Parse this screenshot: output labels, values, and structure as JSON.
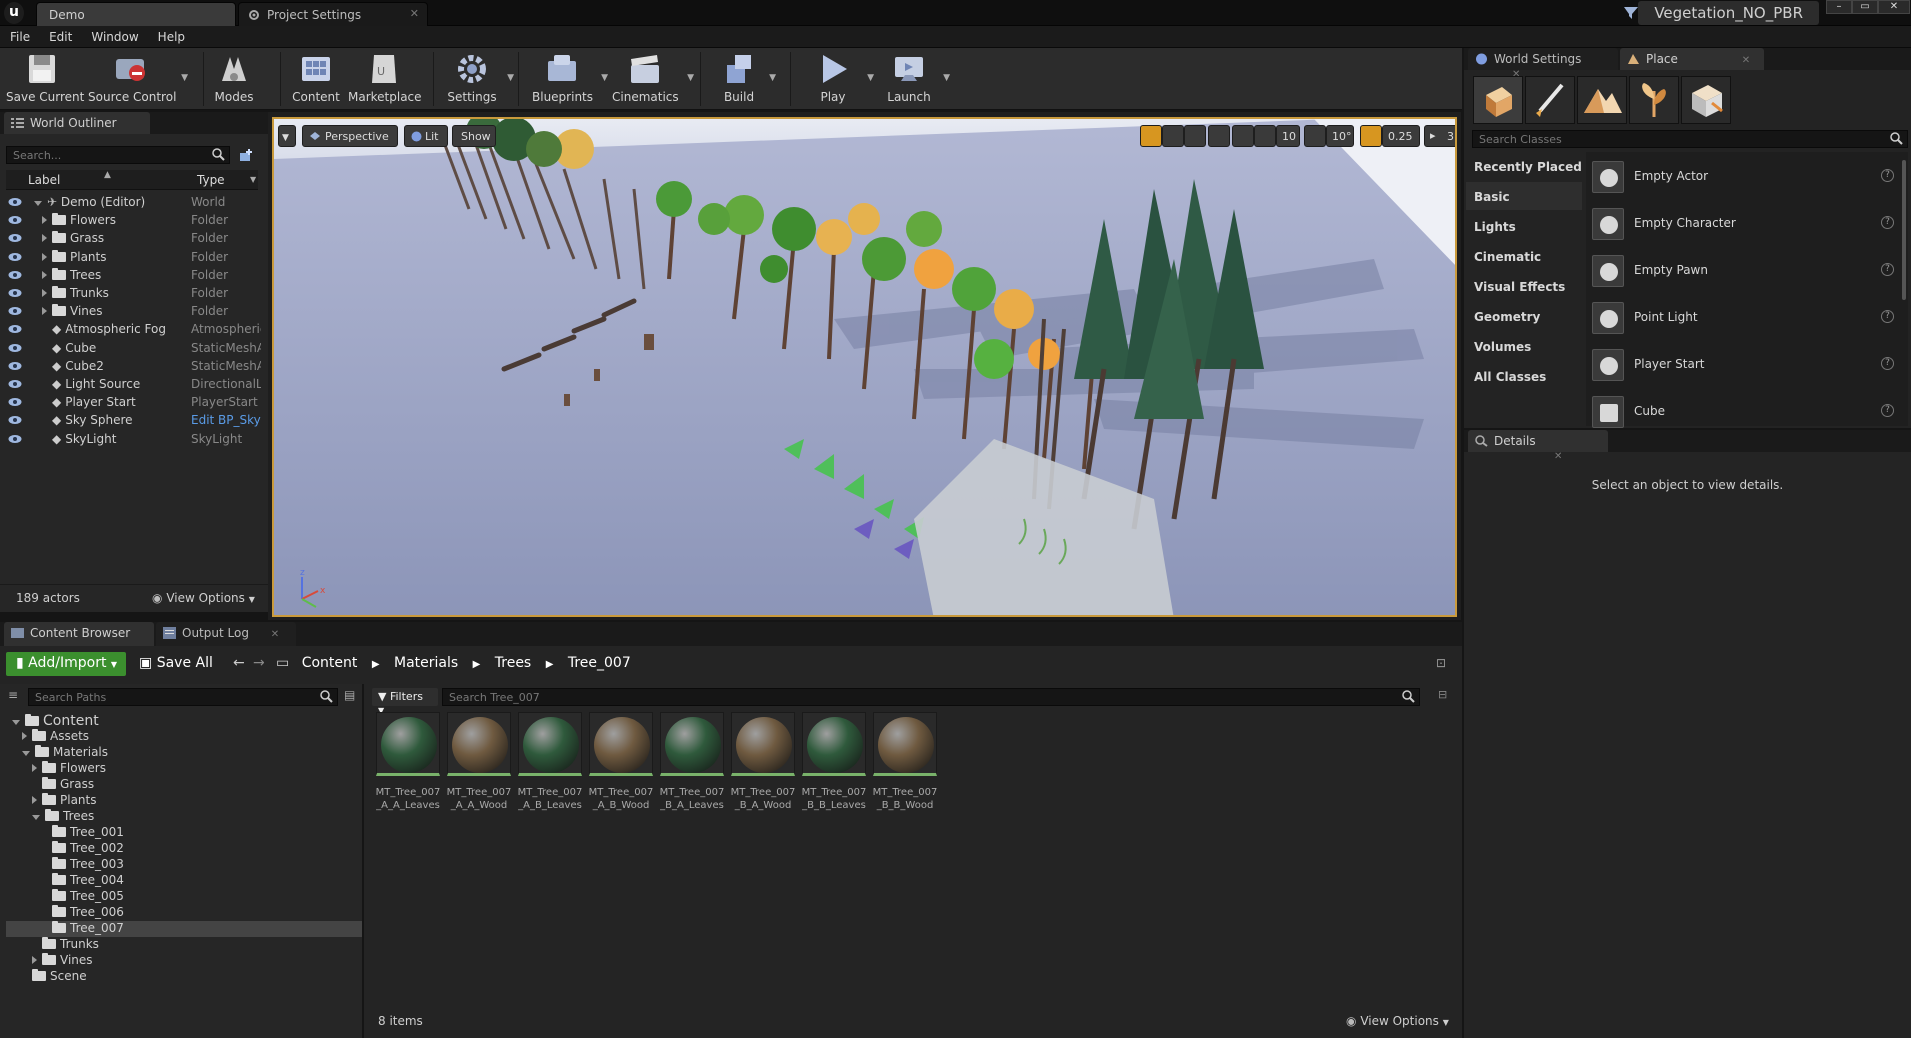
{
  "window": {
    "tabs": [
      {
        "label": "Demo"
      },
      {
        "label": "Project Settings"
      }
    ],
    "project_name": "Vegetation_NO_PBR",
    "controls": {
      "minimize": "–",
      "maximize": "▭",
      "close": "✕"
    }
  },
  "menu": {
    "items": [
      "File",
      "Edit",
      "Window",
      "Help"
    ]
  },
  "toolbar": {
    "buttons": [
      {
        "label": "Save Current",
        "icon": "save-icon"
      },
      {
        "label": "Source Control",
        "icon": "source-control-icon"
      },
      {
        "label": "Modes",
        "icon": "modes-icon"
      },
      {
        "label": "Content",
        "icon": "content-icon"
      },
      {
        "label": "Marketplace",
        "icon": "marketplace-icon"
      },
      {
        "label": "Settings",
        "icon": "settings-icon"
      },
      {
        "label": "Blueprints",
        "icon": "blueprints-icon"
      },
      {
        "label": "Cinematics",
        "icon": "cinematics-icon"
      },
      {
        "label": "Build",
        "icon": "build-icon"
      },
      {
        "label": "Play",
        "icon": "play-icon"
      },
      {
        "label": "Launch",
        "icon": "launch-icon"
      }
    ]
  },
  "outliner": {
    "tab": "World Outliner",
    "search_placeholder": "Search...",
    "col_label": "Label",
    "col_type": "Type",
    "rows": [
      {
        "label": "Demo (Editor)",
        "type": "World"
      },
      {
        "label": "Flowers",
        "type": "Folder"
      },
      {
        "label": "Grass",
        "type": "Folder"
      },
      {
        "label": "Plants",
        "type": "Folder"
      },
      {
        "label": "Trees",
        "type": "Folder"
      },
      {
        "label": "Trunks",
        "type": "Folder"
      },
      {
        "label": "Vines",
        "type": "Folder"
      },
      {
        "label": "Atmospheric Fog",
        "type": "Atmospheric"
      },
      {
        "label": "Cube",
        "type": "StaticMeshA"
      },
      {
        "label": "Cube2",
        "type": "StaticMeshA"
      },
      {
        "label": "Light Source",
        "type": "DirectionalLi"
      },
      {
        "label": "Player Start",
        "type": "PlayerStart"
      },
      {
        "label": "Sky Sphere",
        "type": "Edit BP_Sky"
      },
      {
        "label": "SkyLight",
        "type": "SkyLight"
      }
    ],
    "actor_count": "189 actors",
    "view_options": "View Options"
  },
  "viewport": {
    "perspective": "Perspective",
    "lit": "Lit",
    "show": "Show",
    "grid_snap": "10",
    "rot_snap": "10°",
    "scale_snap": "0.25",
    "cam_speed": "3"
  },
  "content_browser": {
    "tabs": [
      {
        "label": "Content Browser"
      },
      {
        "label": "Output Log"
      }
    ],
    "add_import": "Add/Import",
    "save_all": "Save All",
    "breadcrumb": [
      "Content",
      "Materials",
      "Trees",
      "Tree_007"
    ],
    "search_paths_placeholder": "Search Paths",
    "filters": "Filters",
    "search_assets_placeholder": "Search Tree_007",
    "tree": [
      {
        "label": "Content"
      },
      {
        "label": "Assets"
      },
      {
        "label": "Materials"
      },
      {
        "label": "Flowers"
      },
      {
        "label": "Grass"
      },
      {
        "label": "Plants"
      },
      {
        "label": "Trees"
      },
      {
        "label": "Tree_001"
      },
      {
        "label": "Tree_002"
      },
      {
        "label": "Tree_003"
      },
      {
        "label": "Tree_004"
      },
      {
        "label": "Tree_005"
      },
      {
        "label": "Tree_006"
      },
      {
        "label": "Tree_007"
      },
      {
        "label": "Trunks"
      },
      {
        "label": "Vines"
      },
      {
        "label": "Scene"
      }
    ],
    "assets": [
      {
        "line1": "MT_Tree_007",
        "line2": "_A_A_Leaves",
        "color": "#2f5a3c"
      },
      {
        "line1": "MT_Tree_007",
        "line2": "_A_A_Wood",
        "color": "#6f5a40"
      },
      {
        "line1": "MT_Tree_007",
        "line2": "_A_B_Leaves",
        "color": "#2f5a3c"
      },
      {
        "line1": "MT_Tree_007",
        "line2": "_A_B_Wood",
        "color": "#6f5a40"
      },
      {
        "line1": "MT_Tree_007",
        "line2": "_B_A_Leaves",
        "color": "#2f5a3c"
      },
      {
        "line1": "MT_Tree_007",
        "line2": "_B_A_Wood",
        "color": "#6f5a40"
      },
      {
        "line1": "MT_Tree_007",
        "line2": "_B_B_Leaves",
        "color": "#2f5a3c"
      },
      {
        "line1": "MT_Tree_007",
        "line2": "_B_B_Wood",
        "color": "#6f5a40"
      }
    ],
    "item_count": "8 items",
    "view_options": "View Options"
  },
  "place": {
    "tabs": [
      {
        "label": "World Settings"
      },
      {
        "label": "Place"
      }
    ],
    "search_placeholder": "Search Classes",
    "categories": [
      "Recently Placed",
      "Basic",
      "Lights",
      "Cinematic",
      "Visual Effects",
      "Geometry",
      "Volumes",
      "All Classes"
    ],
    "items": [
      "Empty Actor",
      "Empty Character",
      "Empty Pawn",
      "Point Light",
      "Player Start",
      "Cube"
    ]
  },
  "details": {
    "tab": "Details",
    "empty_message": "Select an object to view details."
  },
  "colors": {
    "accent_orange": "#c99a3c",
    "add_import_green": "#3b8f2e",
    "asset_underline": "#79b26a"
  }
}
